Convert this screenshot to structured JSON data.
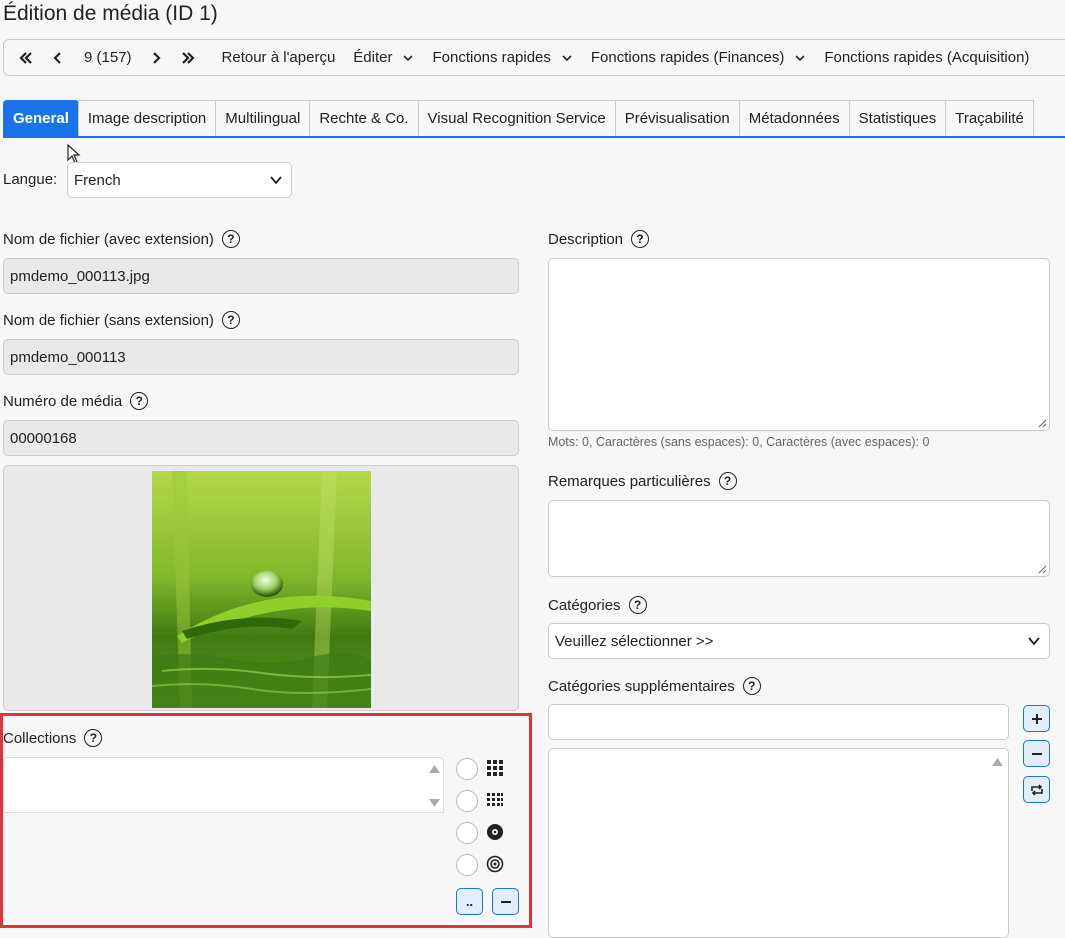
{
  "page": {
    "title": "Édition de média (ID 1)"
  },
  "toolbar": {
    "counter": "9 (157)",
    "items": [
      "Retour à l'aperçu",
      "Éditer",
      "Fonctions rapides",
      "Fonctions rapides (Finances)",
      "Fonctions rapides (Acquisition)"
    ],
    "icons": [
      "first-page-icon",
      "previous-icon",
      "next-icon",
      "last-page-icon"
    ]
  },
  "tabs": [
    "General",
    "Image description",
    "Multilingual",
    "Rechte & Co.",
    "Visual Recognition Service",
    "Prévisualisation",
    "Métadonnées",
    "Statistiques",
    "Traçabilité"
  ],
  "language": {
    "label": "Langue:",
    "value": "French"
  },
  "fields": {
    "filename_ext": {
      "label": "Nom de fichier (avec extension)",
      "value": "pmdemo_000113.jpg"
    },
    "filename_noext": {
      "label": "Nom de fichier (sans extension)",
      "value": "pmdemo_000113"
    },
    "media_number": {
      "label": "Numéro de média",
      "value": "00000168"
    }
  },
  "collections": {
    "label": "Collections",
    "dots_button": ".."
  },
  "description": {
    "label": "Description",
    "counts": "Mots: 0, Caractères (sans espaces): 0, Caractères (avec espaces): 0"
  },
  "remarks": {
    "label": "Remarques particulières"
  },
  "categories": {
    "label": "Catégories",
    "placeholder": "Veuillez sélectionner >>"
  },
  "extra_categories": {
    "label": "Catégories supplémentaires"
  },
  "help_symbol": "?",
  "colors": {
    "accent": "#1a73e8",
    "highlight": "#e0343c",
    "readonly_bg": "#e9e9e9"
  }
}
